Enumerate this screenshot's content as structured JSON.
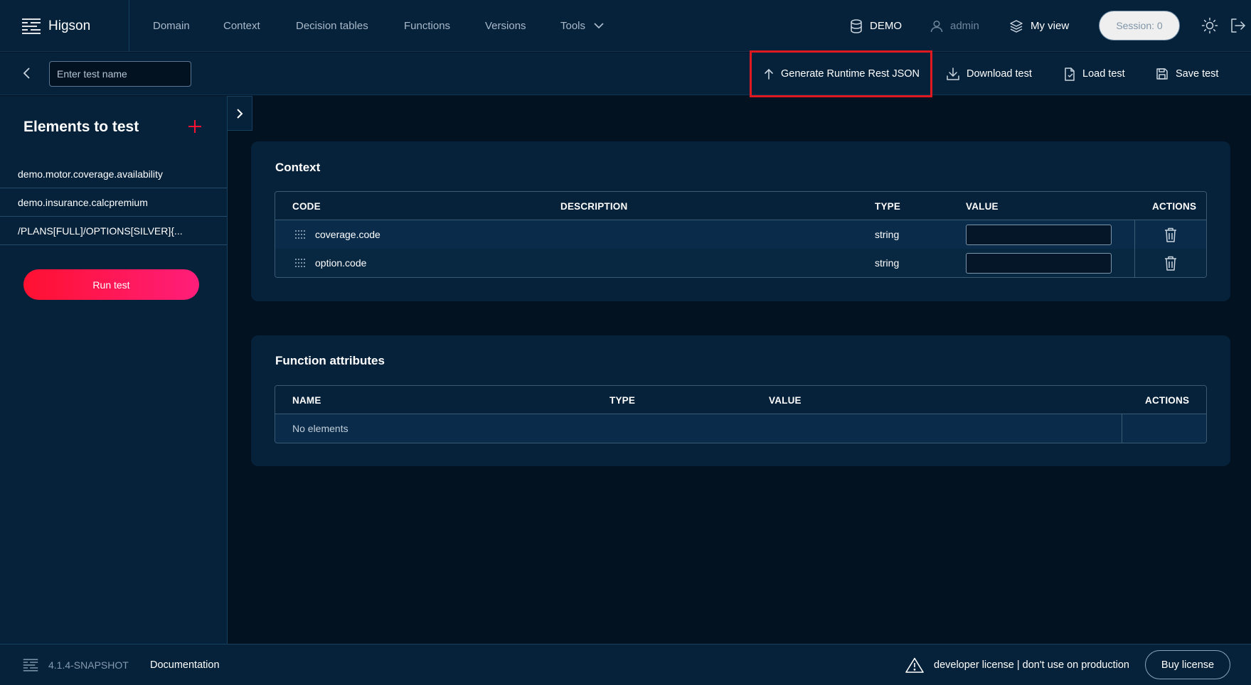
{
  "app": {
    "name": "Higson"
  },
  "nav": {
    "items": [
      "Domain",
      "Context",
      "Decision tables",
      "Functions",
      "Versions",
      "Tools"
    ],
    "environment": "DEMO",
    "user": "admin",
    "view": "My view",
    "session": "Session: 0"
  },
  "toolbar": {
    "test_name_placeholder": "Enter test name",
    "generate_label": "Generate Runtime Rest JSON",
    "download_label": "Download test",
    "load_label": "Load test",
    "save_label": "Save test"
  },
  "sidebar": {
    "title": "Elements to test",
    "items": [
      "demo.motor.coverage.availability",
      "demo.insurance.calcpremium",
      "/PLANS[FULL]/OPTIONS[SILVER]{..."
    ],
    "run_label": "Run test"
  },
  "context": {
    "title": "Context",
    "columns": [
      "CODE",
      "DESCRIPTION",
      "TYPE",
      "VALUE",
      "ACTIONS"
    ],
    "rows": [
      {
        "code": "coverage.code",
        "description": "",
        "type": "string",
        "value": ""
      },
      {
        "code": "option.code",
        "description": "",
        "type": "string",
        "value": ""
      }
    ]
  },
  "function_attributes": {
    "title": "Function attributes",
    "columns": [
      "NAME",
      "TYPE",
      "VALUE",
      "ACTIONS"
    ],
    "empty_text": "No elements"
  },
  "footer": {
    "version": "4.1.4-SNAPSHOT",
    "documentation": "Documentation",
    "license_warning": "developer license | don't use on production",
    "buy_label": "Buy license"
  },
  "colors": {
    "background": "#031221",
    "panel": "#06223b",
    "accent_red": "#ff1131",
    "accent_pink": "#ff1e7a",
    "highlight": "#e0181f"
  }
}
